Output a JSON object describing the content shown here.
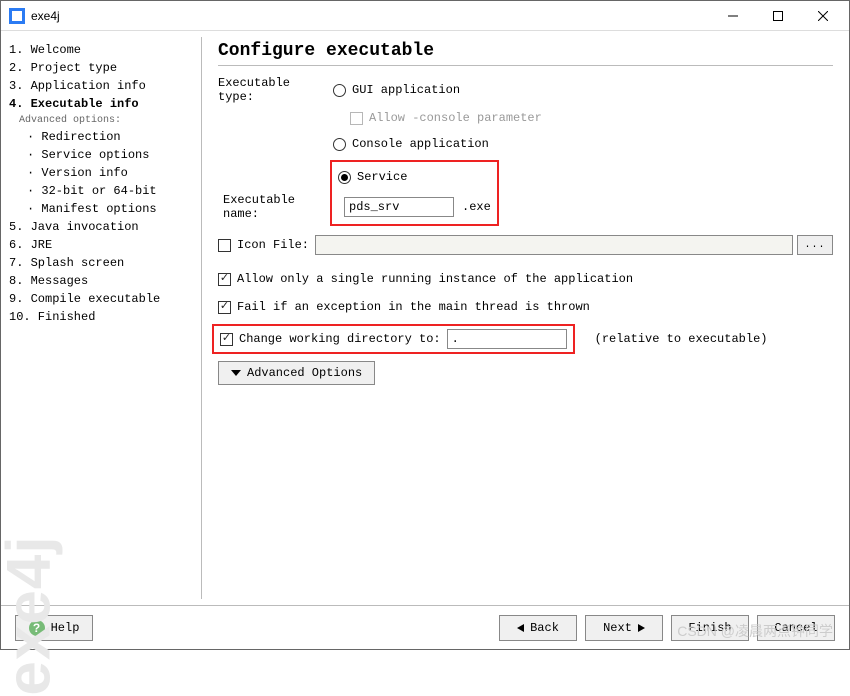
{
  "window": {
    "title": "exe4j"
  },
  "sidebar": {
    "steps": [
      "1. Welcome",
      "2. Project type",
      "3. Application info",
      "4. Executable info",
      "5. Java invocation",
      "6. JRE",
      "7. Splash screen",
      "8. Messages",
      "9. Compile executable",
      "10. Finished"
    ],
    "adv_header": "Advanced options:",
    "adv_items": [
      "Redirection",
      "Service options",
      "Version info",
      "32-bit or 64-bit",
      "Manifest options"
    ],
    "watermark": "exe4j"
  },
  "page": {
    "title": "Configure executable",
    "exec_type_label": "Executable type:",
    "radio_gui": "GUI application",
    "allow_console": "Allow -console parameter",
    "radio_console": "Console application",
    "radio_service": "Service",
    "exec_name_label": "Executable name:",
    "exec_name_value": "pds_srv",
    "exec_suffix": ".exe",
    "icon_file_label": "Icon File:",
    "dots": "...",
    "cb_single_instance": "Allow only a single running instance of the application",
    "cb_fail_exception": "Fail if an exception in the main thread is thrown",
    "cb_change_dir": "Change working directory to:",
    "working_dir_value": ".",
    "rel_text": "(relative to executable)",
    "adv_button": "Advanced Options"
  },
  "footer": {
    "help": "Help",
    "back": "Back",
    "next": "Next",
    "finish": "Finish",
    "cancel": "Cancel"
  },
  "overlay": {
    "csdn": "CSDN @凌晨两点钟同学"
  }
}
